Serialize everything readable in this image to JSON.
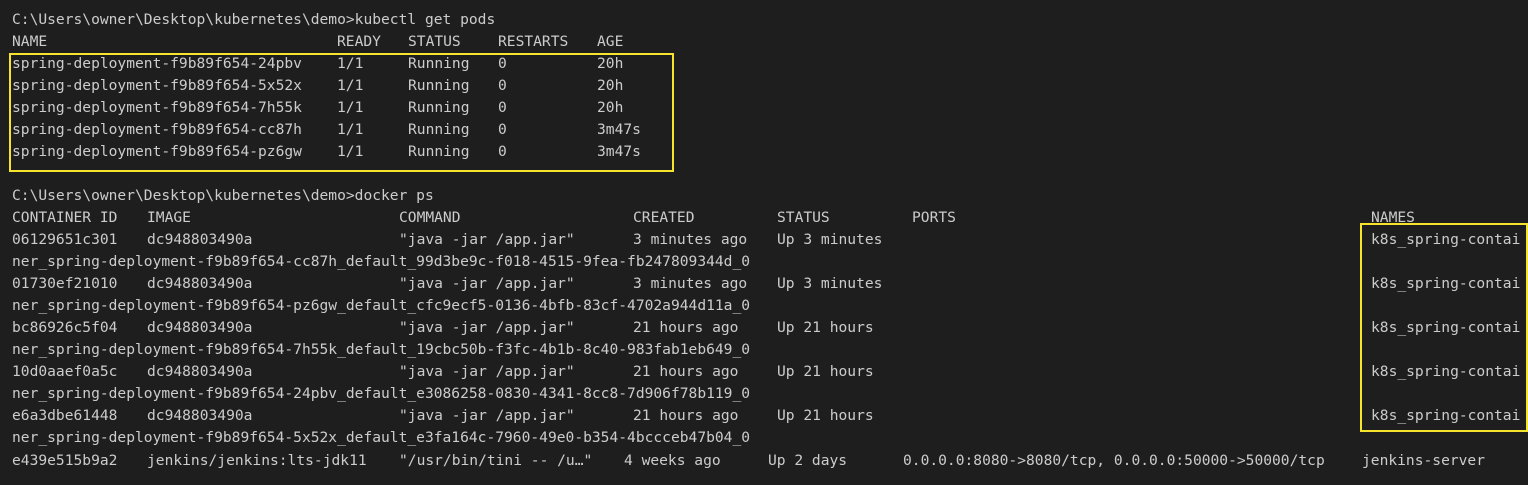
{
  "terminal": {
    "prompt1": "C:\\Users\\owner\\Desktop\\kubernetes\\demo>kubectl get pods",
    "pods_header": [
      "NAME",
      "READY",
      "STATUS",
      "RESTARTS",
      "AGE"
    ],
    "pods": [
      [
        "spring-deployment-f9b89f654-24pbv",
        "1/1",
        "Running",
        "0",
        "20h"
      ],
      [
        "spring-deployment-f9b89f654-5x52x",
        "1/1",
        "Running",
        "0",
        "20h"
      ],
      [
        "spring-deployment-f9b89f654-7h55k",
        "1/1",
        "Running",
        "0",
        "20h"
      ],
      [
        "spring-deployment-f9b89f654-cc87h",
        "1/1",
        "Running",
        "0",
        "3m47s"
      ],
      [
        "spring-deployment-f9b89f654-pz6gw",
        "1/1",
        "Running",
        "0",
        "3m47s"
      ]
    ],
    "prompt2": "C:\\Users\\owner\\Desktop\\kubernetes\\demo>docker ps",
    "docker_header": [
      "CONTAINER ID",
      "IMAGE",
      "COMMAND",
      "CREATED",
      "STATUS",
      "PORTS",
      "NAMES"
    ],
    "containers": [
      {
        "id": "06129651c301",
        "image": "dc948803490a",
        "command": "\"java -jar /app.jar\"",
        "created": "3 minutes ago",
        "status": "Up 3 minutes",
        "ports": "",
        "name": "k8s_spring-contai",
        "wrap": "ner_spring-deployment-f9b89f654-cc87h_default_99d3be9c-f018-4515-9fea-fb247809344d_0"
      },
      {
        "id": "01730ef21010",
        "image": "dc948803490a",
        "command": "\"java -jar /app.jar\"",
        "created": "3 minutes ago",
        "status": "Up 3 minutes",
        "ports": "",
        "name": "k8s_spring-contai",
        "wrap": "ner_spring-deployment-f9b89f654-pz6gw_default_cfc9ecf5-0136-4bfb-83cf-4702a944d11a_0"
      },
      {
        "id": "bc86926c5f04",
        "image": "dc948803490a",
        "command": "\"java -jar /app.jar\"",
        "created": "21 hours ago",
        "status": "Up 21 hours",
        "ports": "",
        "name": "k8s_spring-contai",
        "wrap": "ner_spring-deployment-f9b89f654-7h55k_default_19cbc50b-f3fc-4b1b-8c40-983fab1eb649_0"
      },
      {
        "id": "10d0aaef0a5c",
        "image": "dc948803490a",
        "command": "\"java -jar /app.jar\"",
        "created": "21 hours ago",
        "status": "Up 21 hours",
        "ports": "",
        "name": "k8s_spring-contai",
        "wrap": "ner_spring-deployment-f9b89f654-24pbv_default_e3086258-0830-4341-8cc8-7d906f78b119_0"
      },
      {
        "id": "e6a3dbe61448",
        "image": "dc948803490a",
        "command": "\"java -jar /app.jar\"",
        "created": "21 hours ago",
        "status": "Up 21 hours",
        "ports": "",
        "name": "k8s_spring-contai",
        "wrap": "ner_spring-deployment-f9b89f654-5x52x_default_e3fa164c-7960-49e0-b354-4bccceb47b04_0"
      }
    ],
    "jenkins": {
      "id": "e439e515b9a2",
      "image": "jenkins/jenkins:lts-jdk11",
      "command": "\"/usr/bin/tini -- /u…\"",
      "created": "4 weeks ago",
      "status": "Up 2 days",
      "ports": "0.0.0.0:8080->8080/tcp, 0.0.0.0:50000->50000/tcp",
      "name": "jenkins-server"
    },
    "colors": {
      "background": "#1e1e1e",
      "text": "#cccccc",
      "highlight": "#f5e42b"
    }
  }
}
